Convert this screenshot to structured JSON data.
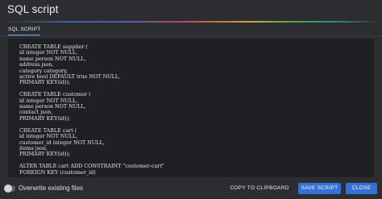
{
  "dialog": {
    "title": "SQL script"
  },
  "tabs": [
    {
      "label": "SQL SCRIPT",
      "active": true
    }
  ],
  "colors": {
    "background": "#2b2d30",
    "code_background": "#1f2023",
    "accent": "#3570d8",
    "tab_underline": "#6fa4ff"
  },
  "code": {
    "text": "CREATE TABLE supplier (\nid integer NOT NULL,\nname person NOT NULL,\naddress json,\ncategory category,\nactive bool DEFAULT true NOT NULL,\nPRIMARY KEY(id));\n\nCREATE TABLE customer (\nid integer NOT NULL,\nname person NOT NULL,\ncontact json,\nPRIMARY KEY(id));\n\nCREATE TABLE cart (\nid integer NOT NULL,\ncustomer_id integer NOT NULL,\nitems json,\nPRIMARY KEY(id));\n\nALTER TABLE cart ADD CONSTRAINT \"customer-cart\"\nFOREIGN KEY (customer_id)"
  },
  "footer": {
    "toggle_label": "Overwrite existing files",
    "toggle_on": false,
    "copy_label": "COPY TO CLIPBOARD",
    "save_label": "SAVE SCRIPT",
    "close_label": "CLOSE"
  }
}
